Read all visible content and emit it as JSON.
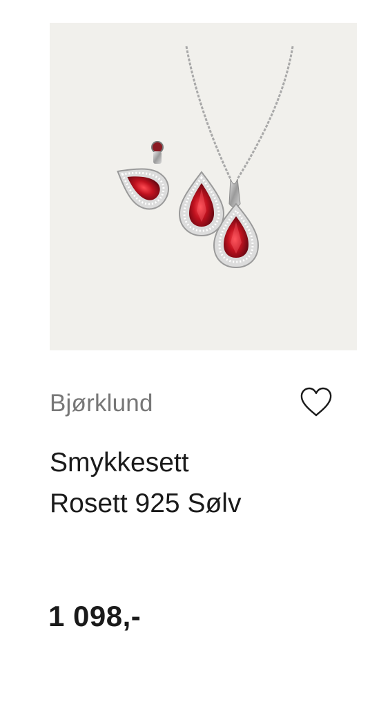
{
  "product": {
    "image_alt": "Smykkesett Rosett 925 Sølv",
    "brand": "Bjørklund",
    "title_line1": "Smykkesett",
    "title_line2": "Rosett 925 Sølv",
    "price": "1 098,-",
    "favorite_icon": "heart-outline-icon"
  },
  "colors": {
    "image_background": "#f1f0ec",
    "gem_red": "#c0121f",
    "silver": "#b9b9b9",
    "brand_gray": "#777777",
    "text": "#1a1a1a"
  }
}
